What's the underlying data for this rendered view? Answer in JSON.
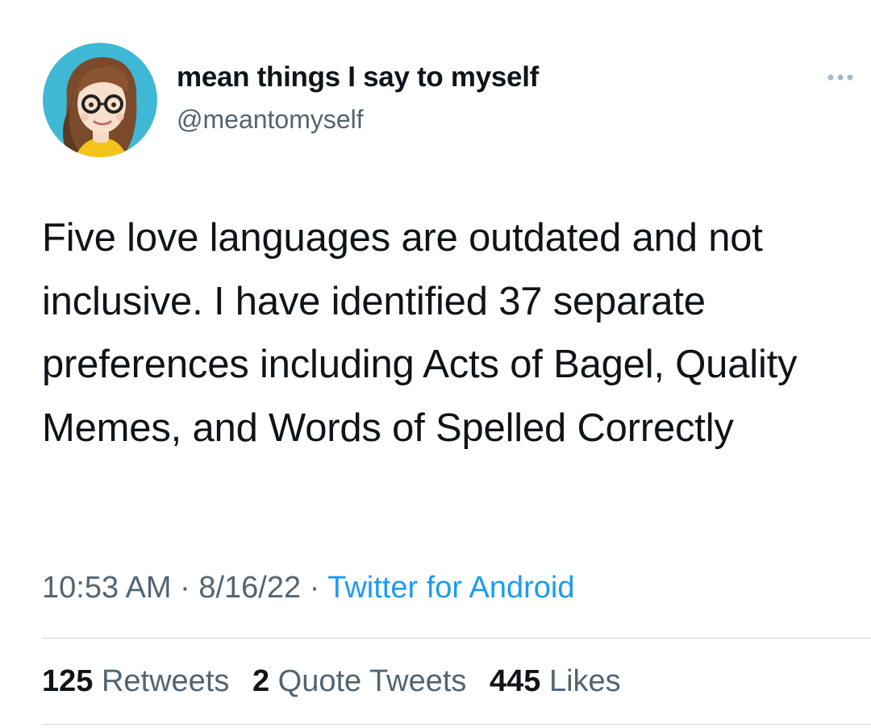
{
  "tweet": {
    "author": {
      "display_name": "mean things I say to myself",
      "handle": "@meantomyself",
      "avatar_icon": "cartoon-woman-avatar"
    },
    "more_icon": "more-options-icon",
    "text": "Five love languages are outdated and not inclusive. I have identified 37 separate preferences including Acts of Bagel, Quality Memes, and Words of Spelled Correctly",
    "time": "10:53 AM",
    "separator": "·",
    "date": "8/16/22",
    "source": "Twitter for Android",
    "stats": {
      "retweets_count": "125",
      "retweets_label": "Retweets",
      "quotes_count": "2",
      "quotes_label": "Quote Tweets",
      "likes_count": "445",
      "likes_label": "Likes"
    },
    "colors": {
      "text": "#0f1419",
      "secondary": "#536471",
      "link": "#1d9bf0",
      "avatar_bg": "#3fb8d6",
      "divider": "#cfd9de"
    }
  }
}
